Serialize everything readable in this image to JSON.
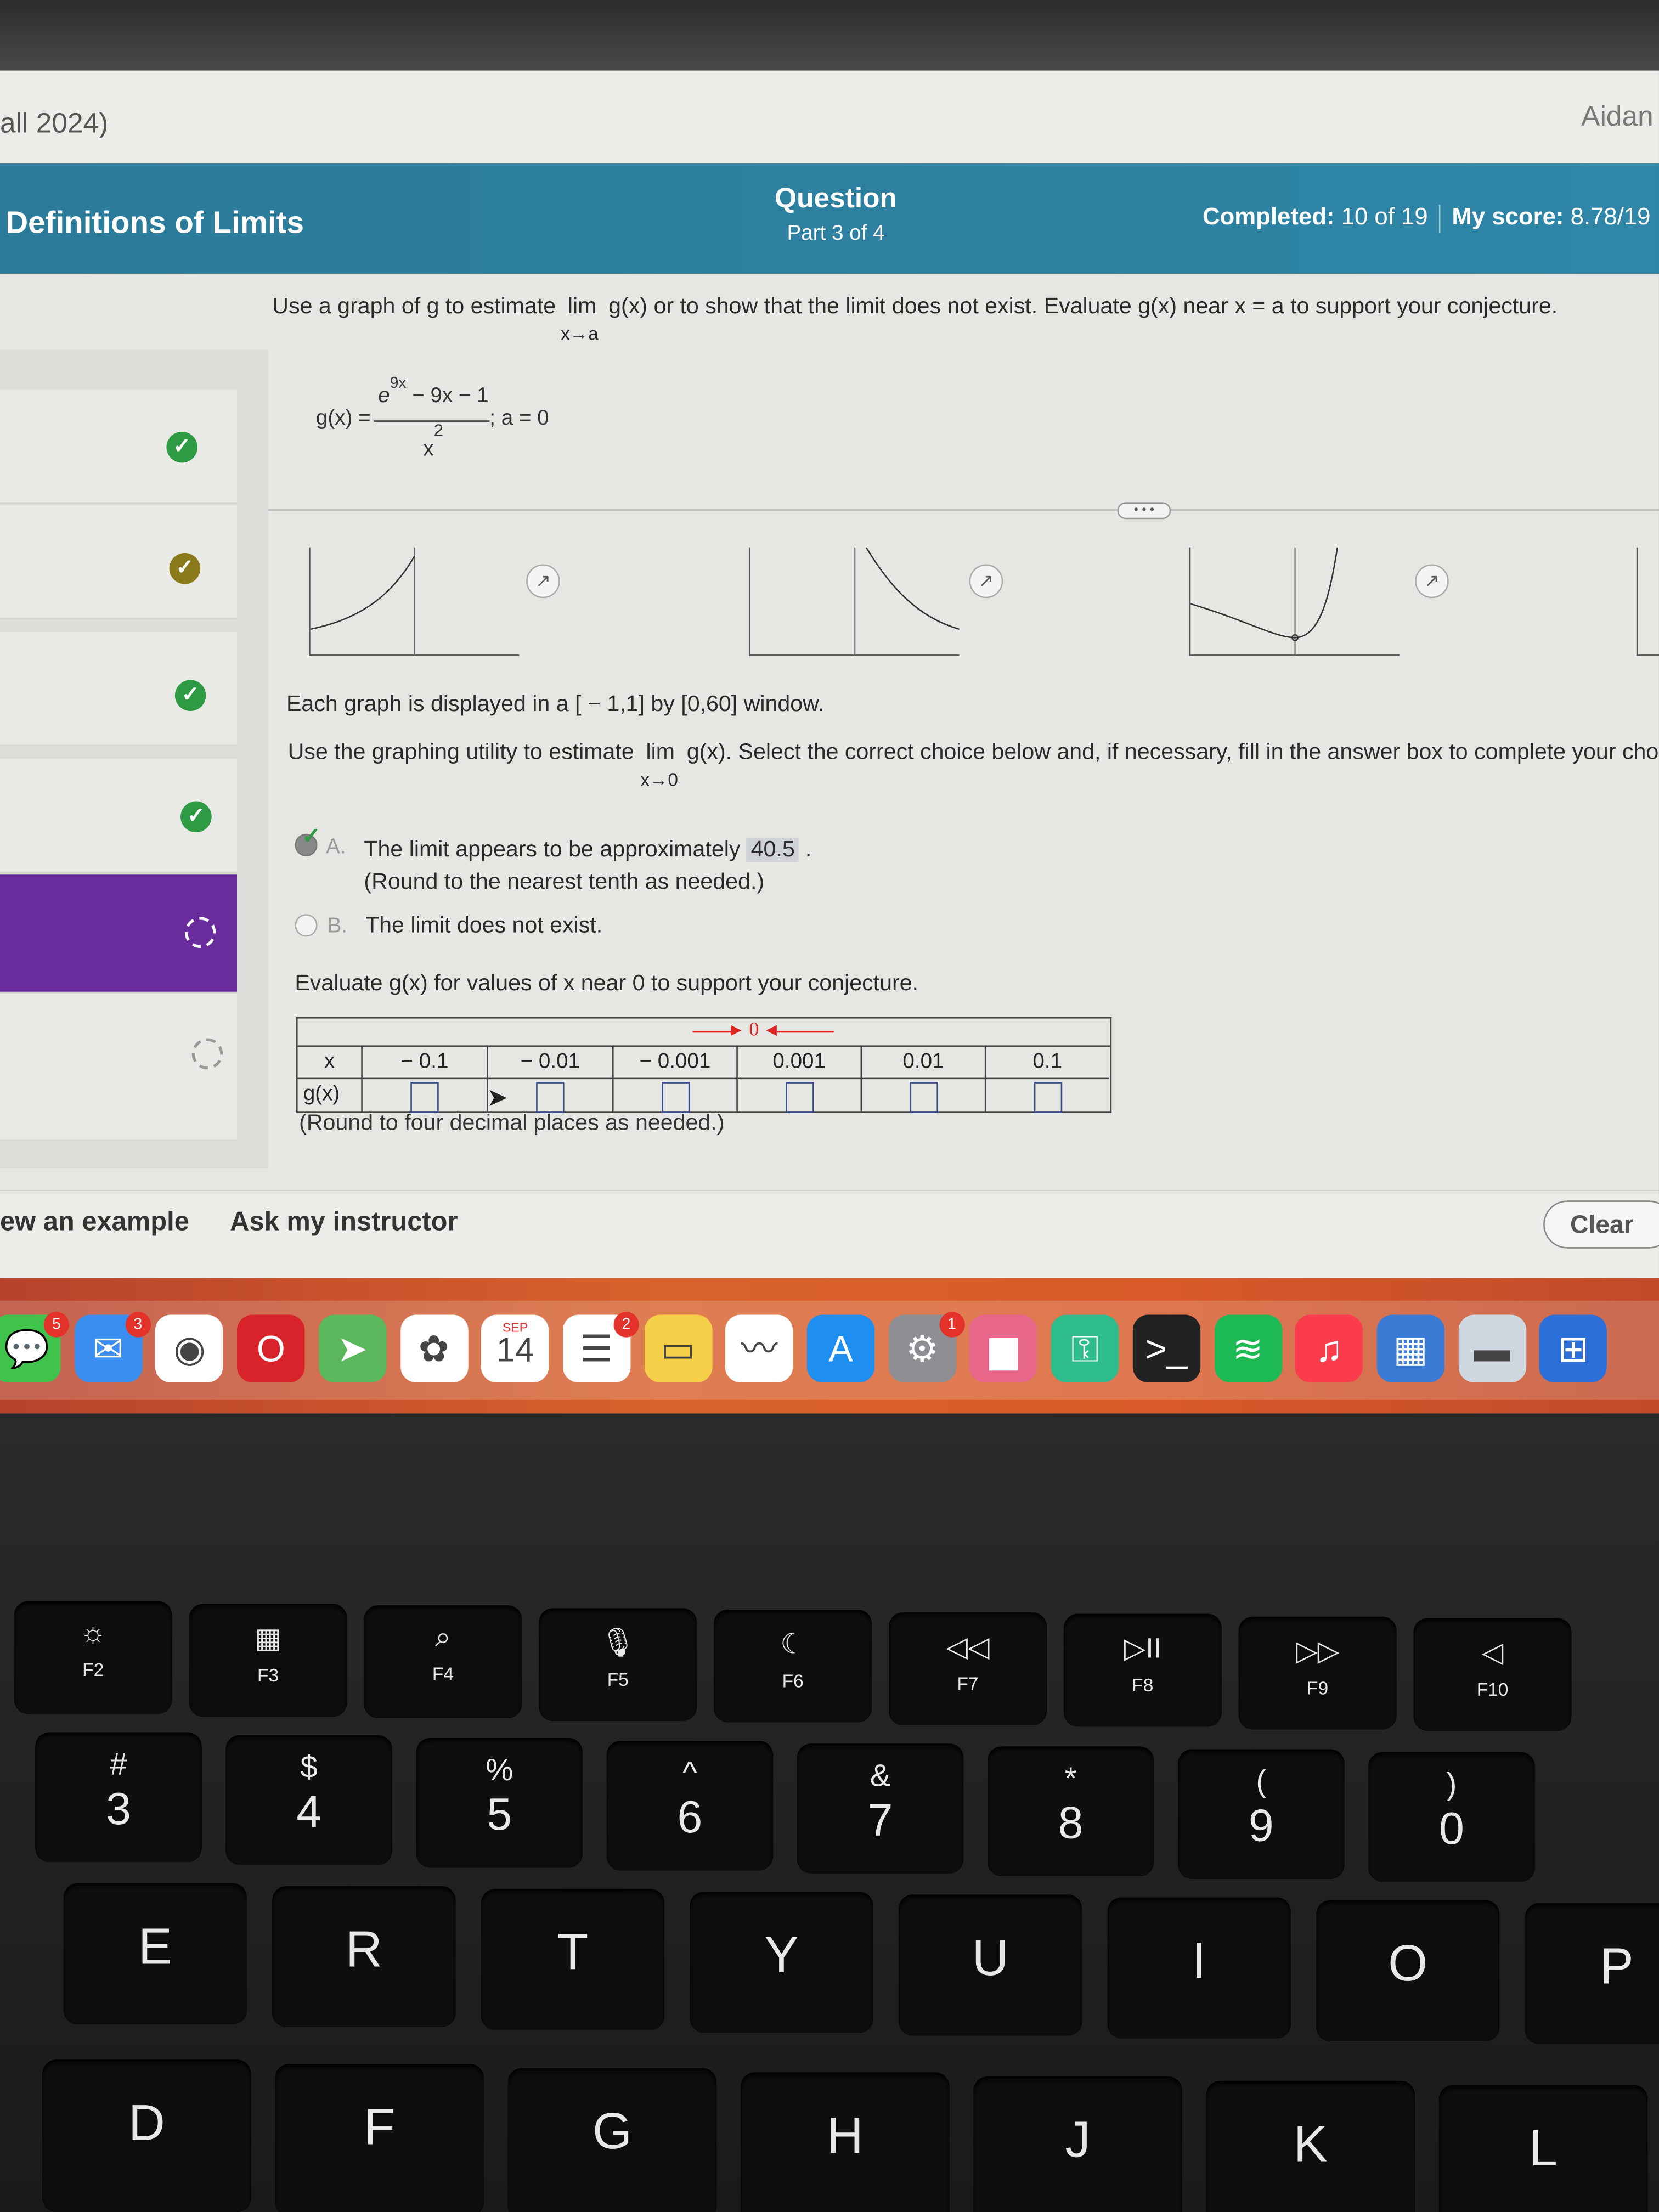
{
  "header": {
    "course": "all 2024)",
    "user": "Aidan"
  },
  "banner": {
    "section_title": "Definitions of Limits",
    "question_label": "Question",
    "part": "Part 3 of 4",
    "completed_label": "Completed:",
    "completed_value": "10 of 19",
    "score_label": "My score:",
    "score_value": "8.78/19"
  },
  "sidebar": {
    "items": [
      {
        "status": "correct",
        "icon": "check-icon"
      },
      {
        "status": "partial",
        "icon": "partial-check-icon"
      },
      {
        "status": "correct",
        "icon": "check-icon"
      },
      {
        "status": "correct",
        "icon": "check-icon"
      },
      {
        "status": "in-progress",
        "icon": "dashed-circle-icon",
        "active": true
      },
      {
        "status": "not-started",
        "icon": "dashed-circle-icon"
      }
    ]
  },
  "question": {
    "prompt_pre": "Use a graph of g to estimate",
    "lim": "lim",
    "lim_sub": "x→a",
    "prompt_post": "g(x) or to show that the limit does not exist. Evaluate g(x) near x = a to support your conjecture.",
    "func_lhs": "g(x) =",
    "numerator_e": "e",
    "numerator_exp": "9x",
    "numerator_rest": " − 9x − 1",
    "denominator": "x",
    "denominator_exp": "2",
    "a_value": "; a = 0",
    "more": "• • •",
    "window_text": "Each graph is displayed in a [ − 1,1] by [0,60] window.",
    "instr_pre": "Use the graphing utility to estimate",
    "instr_lim_sub": "x→0",
    "instr_post": "g(x). Select the correct choice below and, if necessary, fill in the answer box to complete your choice.",
    "choices": [
      {
        "letter": "A.",
        "text": "The limit appears to be approximately",
        "answer": "40.5",
        "note": "(Round to the nearest tenth as needed.)",
        "selected": true,
        "correct": true
      },
      {
        "letter": "B.",
        "text": "The limit does not exist.",
        "selected": false
      }
    ],
    "evaluate_text": "Evaluate g(x) for values of x near 0 to support your conjecture.",
    "table": {
      "approach_label": "0",
      "x_label": "x",
      "g_label": "g(x)",
      "x_values": [
        "− 0.1",
        "− 0.01",
        "− 0.001",
        "0.001",
        "0.01",
        "0.1"
      ],
      "g_values": [
        "",
        "",
        "",
        "",
        "",
        ""
      ]
    },
    "table_note": "(Round to four decimal places as needed.)"
  },
  "footer": {
    "view_example": "ew an example",
    "ask_instructor": "Ask my instructor",
    "clear": "Clear"
  },
  "dock": {
    "apps": [
      {
        "name": "messages",
        "badge": "5",
        "color": "#3fc34d",
        "glyph": "💬"
      },
      {
        "name": "mail",
        "badge": "3",
        "color": "#3a8ef0",
        "glyph": "✉"
      },
      {
        "name": "chrome",
        "color": "#ffffff",
        "glyph": "◉"
      },
      {
        "name": "opera",
        "color": "#d8232a",
        "glyph": "O"
      },
      {
        "name": "maps",
        "color": "#5cb85c",
        "glyph": "➤"
      },
      {
        "name": "photos",
        "color": "#ffffff",
        "glyph": "✿"
      },
      {
        "name": "calendar",
        "color": "#ffffff",
        "glyph": "14",
        "month": "SEP"
      },
      {
        "name": "reminders",
        "badge": "2",
        "color": "#ffffff",
        "glyph": "☰"
      },
      {
        "name": "notes",
        "color": "#f7d04a",
        "glyph": "▭"
      },
      {
        "name": "freeform",
        "color": "#ffffff",
        "glyph": "〰"
      },
      {
        "name": "app-store",
        "color": "#1f8ef1",
        "glyph": "A"
      },
      {
        "name": "system-settings",
        "badge": "1",
        "color": "#8e8e93",
        "glyph": "⚙"
      },
      {
        "name": "keynote",
        "color": "#e8668a",
        "glyph": "▆"
      },
      {
        "name": "passwords",
        "color": "#2ebc8c",
        "glyph": "⚿"
      },
      {
        "name": "terminal",
        "color": "#222222",
        "glyph": ">_"
      },
      {
        "name": "spotify",
        "color": "#1db954",
        "glyph": "≋"
      },
      {
        "name": "music",
        "color": "#fa3c4c",
        "glyph": "♫"
      },
      {
        "name": "finder-app",
        "color": "#3a7bd5",
        "glyph": "▦"
      },
      {
        "name": "preview",
        "color": "#cfd8e0",
        "glyph": "▬"
      },
      {
        "name": "windows-app",
        "color": "#2d6fd8",
        "glyph": "⊞"
      }
    ]
  },
  "keyboard": {
    "fn_row": [
      {
        "icon": "☼",
        "label": "F2"
      },
      {
        "icon": "▦",
        "label": "F3"
      },
      {
        "icon": "⌕",
        "label": "F4"
      },
      {
        "icon": "🎙",
        "label": "F5"
      },
      {
        "icon": "☾",
        "label": "F6"
      },
      {
        "icon": "◁◁",
        "label": "F7"
      },
      {
        "icon": "▷II",
        "label": "F8"
      },
      {
        "icon": "▷▷",
        "label": "F9"
      },
      {
        "icon": "◁",
        "label": "F10"
      }
    ],
    "num_row": [
      {
        "top": "#",
        "main": "3"
      },
      {
        "top": "$",
        "main": "4"
      },
      {
        "top": "%",
        "main": "5"
      },
      {
        "top": "^",
        "main": "6"
      },
      {
        "top": "&",
        "main": "7"
      },
      {
        "top": "*",
        "main": "8"
      },
      {
        "top": "(",
        "main": "9"
      },
      {
        "top": ")",
        "main": "0"
      }
    ],
    "row_qwerty": [
      "E",
      "R",
      "T",
      "Y",
      "U",
      "I",
      "O",
      "P"
    ],
    "row_home": [
      "D",
      "F",
      "G",
      "H",
      "J",
      "K",
      "L"
    ]
  }
}
